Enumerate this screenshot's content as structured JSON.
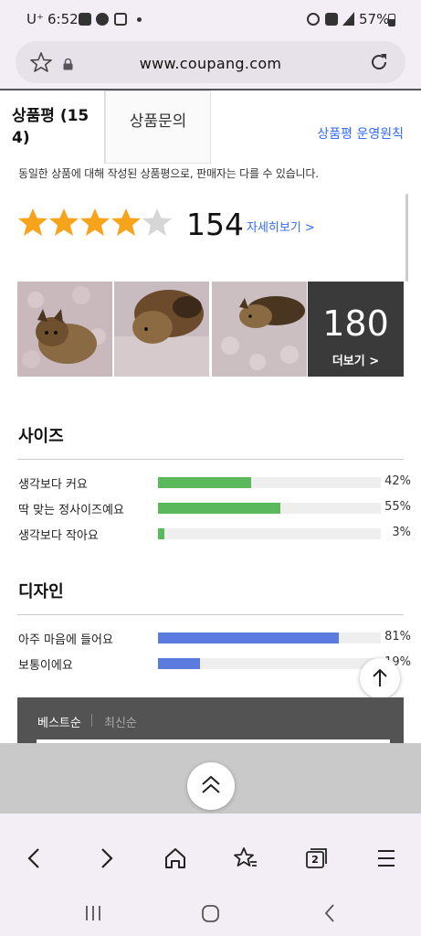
{
  "status_bar": {
    "carrier": "U⁺",
    "time": "6:52",
    "battery": "57%"
  },
  "browser": {
    "url": "www.coupang.com",
    "tab_count": "2"
  },
  "tabs": {
    "review_tab_line1": "상품평 (15",
    "review_tab_line2": "4)",
    "inquiry_tab": "상품문의",
    "policy_link": "상품평 운영원칙"
  },
  "notice": "동일한 상품에 대해 작성된 상품평으로, 판매자는 다를 수 있습니다.",
  "rating": {
    "stars": 4.5,
    "count": "154",
    "more_link": "자세히보기 >"
  },
  "photos": {
    "more_count": "180",
    "more_label": "더보기 >"
  },
  "survey": {
    "size": {
      "title": "사이즈",
      "rows": [
        {
          "label": "생각보다 커요",
          "percent": 42,
          "pct_text": "42%",
          "color": "#5cb85c"
        },
        {
          "label": "딱 맞는 정사이즈예요",
          "percent": 55,
          "pct_text": "55%",
          "color": "#5cb85c"
        },
        {
          "label": "생각보다 작아요",
          "percent": 3,
          "pct_text": "3%",
          "color": "#5cb85c"
        }
      ]
    },
    "design": {
      "title": "디자인",
      "rows": [
        {
          "label": "아주 마음에 들어요",
          "percent": 81,
          "pct_text": "81%",
          "color": "#5b7be0"
        },
        {
          "label": "보통이에요",
          "percent": 19,
          "pct_text": "19%",
          "color": "#5b7be0"
        }
      ]
    }
  },
  "sort": {
    "best": "베스트순",
    "newest": "최신순"
  },
  "colors": {
    "link": "#346aff",
    "star": "#f7a41d",
    "bar_green": "#5cb85c",
    "bar_blue": "#5b7be0"
  }
}
